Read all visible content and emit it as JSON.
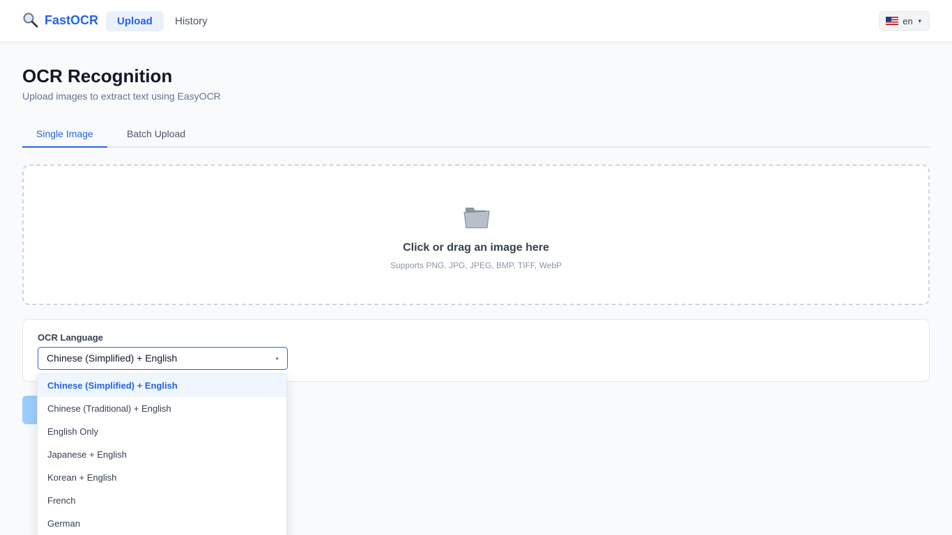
{
  "header": {
    "brand": "FastOCR",
    "nav": [
      {
        "label": "Upload"
      },
      {
        "label": "History"
      }
    ],
    "language_button": "en"
  },
  "page": {
    "title": "OCR Recognition",
    "subtitle": "Upload images to extract text using EasyOCR"
  },
  "tabs": [
    {
      "label": "Single Image"
    },
    {
      "label": "Batch Upload"
    }
  ],
  "dropzone": {
    "title": "Click or drag an image here",
    "hint": "Supports PNG, JPG, JPEG, BMP, TIFF, WebP"
  },
  "language_panel": {
    "label": "OCR Language",
    "selected": "Chinese (Simplified) + English",
    "options": [
      "Chinese (Simplified) + English",
      "Chinese (Traditional) + English",
      "English Only",
      "Japanese + English",
      "Korean + English",
      "French",
      "German"
    ]
  },
  "colors": {
    "accent": "#2563eb",
    "background": "#f8fafc",
    "button_disabled": "#93c5fd"
  }
}
